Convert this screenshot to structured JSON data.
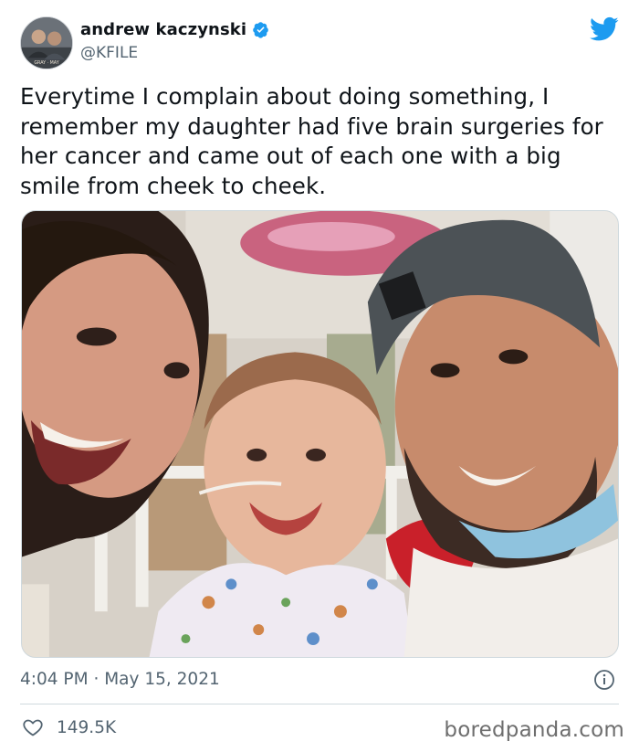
{
  "author": {
    "display_name": "andrew kaczynski",
    "handle": "@KFILE",
    "verified": true,
    "avatar_caption": "GRAY · MAY"
  },
  "tweet": {
    "text": "Everytime I complain about doing something, I remember my daughter had five brain surgeries for her cancer and came out of each one with a big smile from cheek to cheek.",
    "time": "4:04 PM",
    "separator": "·",
    "date": "May 15, 2021",
    "likes": "149.5K"
  },
  "icons": {
    "verified": "verified-badge-icon",
    "logo": "twitter-bird-icon",
    "info": "info-icon",
    "like": "heart-icon"
  },
  "colors": {
    "brand_blue": "#1d9bf0",
    "text_primary": "#0f1419",
    "text_secondary": "#536471",
    "divider": "#cfd9de"
  },
  "watermark": "boredpanda.com"
}
